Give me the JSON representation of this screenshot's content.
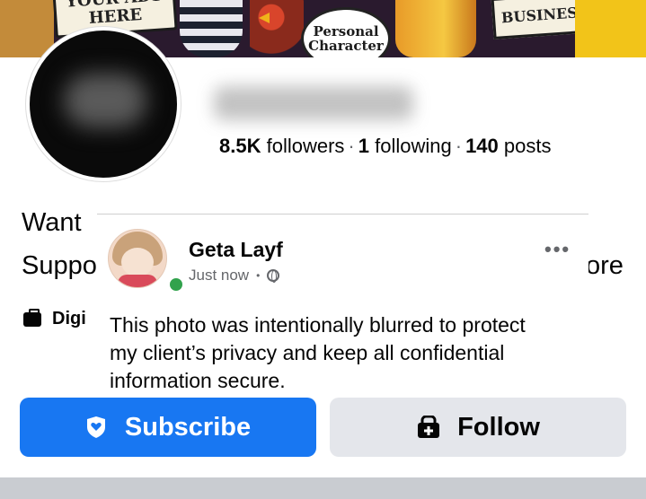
{
  "cover": {
    "sign_left_text": "YOUR ADS HERE",
    "bubble_text": "Personal Character",
    "sign_right_text": "BUSINESS"
  },
  "profile": {
    "followers_count": "8.5K",
    "followers_label": "followers",
    "following_count": "1",
    "following_label": "following",
    "posts_count": "140",
    "posts_label": "posts",
    "separator": "·"
  },
  "bio": {
    "line1_start": "Want",
    "line2_start": "Suppo",
    "more_fragment": "ore",
    "category_fragment": "Digi"
  },
  "overlay_post": {
    "author": "Geta Layf",
    "timestamp": "Just now",
    "dot": "•",
    "menu": "•••",
    "text": "This photo was intentionally blurred to protect my client’s privacy and keep all confidential information secure."
  },
  "actions": {
    "subscribe_label": "Subscribe",
    "follow_label": "Follow"
  },
  "colors": {
    "primary_blue": "#1877f2",
    "secondary_gray": "#e4e6eb",
    "online_green": "#31a24c"
  },
  "icons": {
    "subscribe": "shield-heart-icon",
    "follow": "add-friend-icon",
    "category": "briefcase-icon",
    "privacy": "globe-icon"
  }
}
